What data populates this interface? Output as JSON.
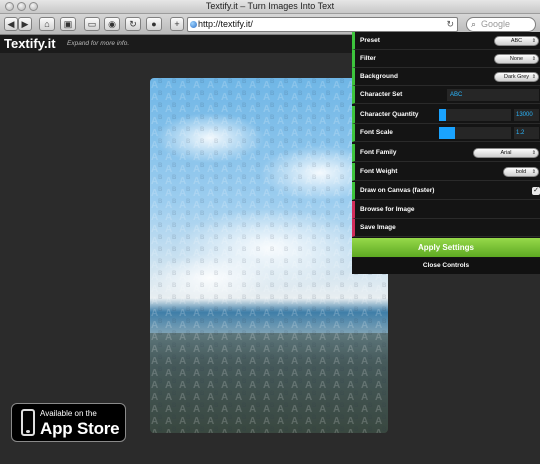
{
  "window": {
    "title": "Textify.it – Turn Images Into Text"
  },
  "toolbar": {
    "back_glyph": "◀",
    "forward_glyph": "▶",
    "home_glyph": "⌂",
    "history_glyph": "▣",
    "screen_glyph": "▭",
    "bookmark_glyph": "◉",
    "reload_glyph": "↻",
    "stop_glyph": "●",
    "add_glyph": "+",
    "url": "http://textify.it/",
    "search_placeholder": "Google"
  },
  "site": {
    "logo": "Textify.it",
    "expand_hint": "Expand for more info."
  },
  "appstore": {
    "line1": "Available on the",
    "line2": "App Store"
  },
  "controls": {
    "preset_label": "Preset",
    "preset_value": "ABC",
    "filter_label": "Filter",
    "filter_value": "None",
    "background_label": "Background",
    "background_value": "Dark Grey",
    "character_set_label": "Character Set",
    "character_set_value": "ABC",
    "character_quantity_label": "Character Quantity",
    "character_quantity_value": "13000",
    "character_quantity_fraction": 0.1,
    "font_scale_label": "Font Scale",
    "font_scale_value": "1.2",
    "font_scale_fraction": 0.22,
    "font_family_label": "Font Family",
    "font_family_value": "Arial",
    "font_weight_label": "Font Weight",
    "font_weight_value": "bold",
    "draw_on_canvas_label": "Draw on Canvas (faster)",
    "draw_on_canvas_checked": "✓",
    "browse_label": "Browse for Image",
    "save_label": "Save Image",
    "apply_label": "Apply Settings",
    "close_label": "Close Controls"
  },
  "colors": {
    "accent_green": "#3dc43d",
    "accent_pink": "#d22c5b",
    "value_blue": "#2bb7ff",
    "apply_green": "#78c136"
  }
}
